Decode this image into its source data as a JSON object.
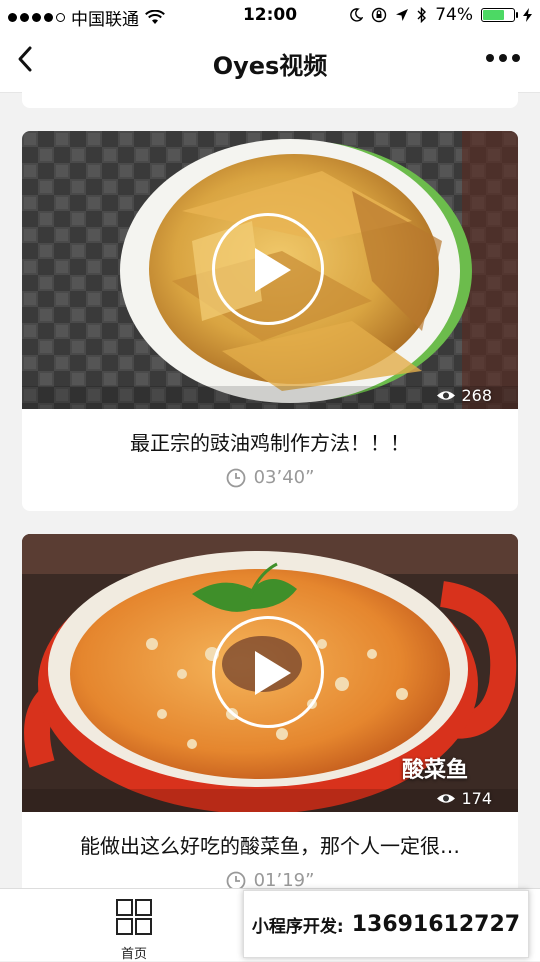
{
  "status": {
    "carrier": "中国联通",
    "time": "12:00",
    "battery": "74%",
    "battery_level": 0.74,
    "accent": "#4cd964"
  },
  "navbar": {
    "title": "Oyes视频",
    "back_icon": "chevron-left-icon",
    "more_icon": "more-dots-icon"
  },
  "videos": [
    {
      "title": "最正宗的豉油鸡制作方法！！！",
      "duration": "03’40”",
      "views": "268",
      "overlay_label": ""
    },
    {
      "title": "能做出这么好吃的酸菜鱼，那个人一定很…",
      "duration": "01’19”",
      "views": "174",
      "overlay_label": "酸菜鱼"
    }
  ],
  "tabbar": {
    "home_label": "首页",
    "home_icon": "grid-icon"
  },
  "promo": {
    "label": "小程序开发:",
    "phone": "13691612727"
  }
}
